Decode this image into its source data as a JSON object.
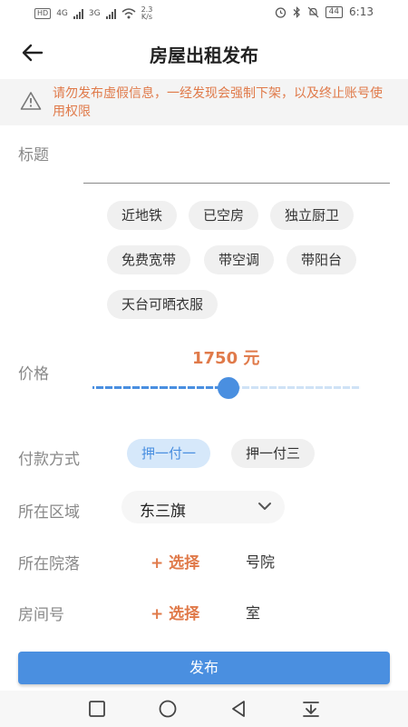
{
  "status_bar": {
    "net_left": "HD",
    "sim1": "4G",
    "sim2": "3G",
    "speed_value": "2.3",
    "speed_unit": "K/s",
    "battery": "44",
    "time": "6:13"
  },
  "header": {
    "title": "房屋出租发布"
  },
  "warning": {
    "text": "请勿发布虚假信息，一经发现会强制下架，以及终止账号使用权限"
  },
  "form": {
    "title_label": "标题",
    "tags": [
      "近地铁",
      "已空房",
      "独立厨卫",
      "免费宽带",
      "带空调",
      "带阳台",
      "天台可晒衣服"
    ],
    "price_label": "价格",
    "price_display": "1750 元",
    "price_slider_fraction": 0.5,
    "payment_label": "付款方式",
    "payment_options": [
      "押一付一",
      "押一付三"
    ],
    "payment_selected": "押一付一",
    "region_label": "所在区域",
    "region_value": "东三旗",
    "courtyard_label": "所在院落",
    "courtyard_select": "+ 选择",
    "courtyard_suffix": "号院",
    "room_label": "房间号",
    "room_select": "+ 选择",
    "room_suffix": "室"
  },
  "actions": {
    "publish_label": "发布"
  },
  "colors": {
    "accent": "#4a8fe0",
    "warning": "#e07a4a"
  }
}
